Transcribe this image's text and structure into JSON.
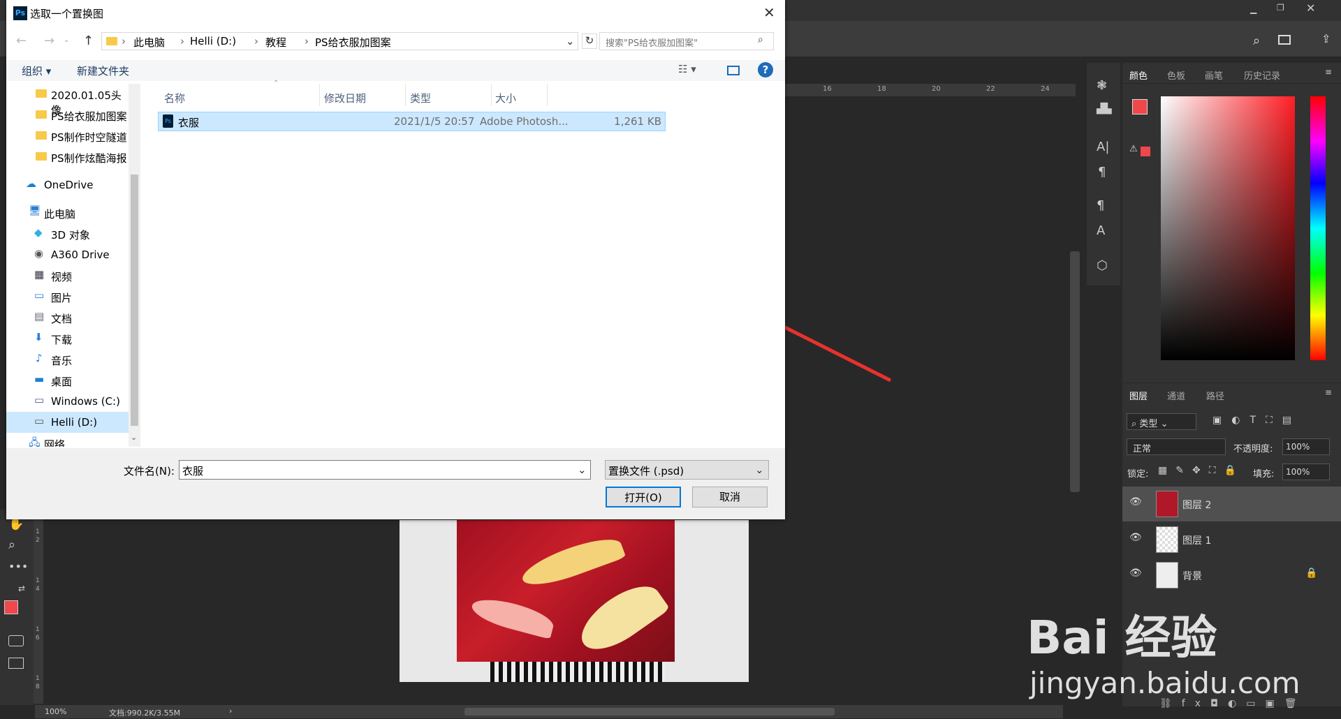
{
  "photoshop": {
    "ruler_ticks": [
      "16",
      "18",
      "20",
      "22",
      "24"
    ],
    "left_ruler": [
      "1",
      "2",
      "1",
      "4",
      "1",
      "6",
      "1",
      "8"
    ],
    "status": {
      "zoom": "100%",
      "doc": "文档:990.2K/3.55M",
      "arrow": "›"
    },
    "panel_tabs": [
      "颜色",
      "色板",
      "画笔",
      "历史记录"
    ],
    "layer_tabs": [
      "图层",
      "通道",
      "路径"
    ],
    "filter_label": "类型",
    "blend_mode": "正常",
    "opacity_label": "不透明度:",
    "opacity_value": "100%",
    "lock_label": "锁定:",
    "fill_label": "填充:",
    "fill_value": "100%",
    "layers": [
      {
        "name": "图层 2"
      },
      {
        "name": "图层 1"
      },
      {
        "name": "背景"
      }
    ],
    "fg_color": "#f0474b",
    "bg_color": "#000000"
  },
  "dialog": {
    "title": "选取一个置换图",
    "app_icon": "Ps",
    "breadcrumb": [
      "此电脑",
      "Helli (D:)",
      "教程",
      "PS给衣服加图案"
    ],
    "search_placeholder": "搜索\"PS给衣服加图案\"",
    "organize": "组织 ▾",
    "new_folder": "新建文件夹",
    "nav": [
      {
        "label": "2020.01.05头像",
        "icon": "folder-icon"
      },
      {
        "label": "PS给衣服加图案",
        "icon": "folder-icon"
      },
      {
        "label": "PS制作时空隧道",
        "icon": "folder-icon"
      },
      {
        "label": "PS制作炫酷海报",
        "icon": "folder-icon"
      },
      {
        "label": "OneDrive",
        "icon": "cloud-icon"
      },
      {
        "label": "此电脑",
        "icon": "computer-icon"
      },
      {
        "label": "3D 对象",
        "icon": "cube-icon"
      },
      {
        "label": "A360 Drive",
        "icon": "drive-icon"
      },
      {
        "label": "视频",
        "icon": "video-icon"
      },
      {
        "label": "图片",
        "icon": "picture-icon"
      },
      {
        "label": "文档",
        "icon": "document-icon"
      },
      {
        "label": "下载",
        "icon": "download-icon"
      },
      {
        "label": "音乐",
        "icon": "music-icon"
      },
      {
        "label": "桌面",
        "icon": "desktop-icon"
      },
      {
        "label": "Windows (C:)",
        "icon": "disk-icon"
      },
      {
        "label": "Helli (D:)",
        "icon": "disk-icon"
      },
      {
        "label": "网络",
        "icon": "network-icon"
      }
    ],
    "columns": {
      "name": "名称",
      "date": "修改日期",
      "type": "类型",
      "size": "大小"
    },
    "files": [
      {
        "name": "衣服",
        "date": "2021/1/5 20:57",
        "type": "Adobe Photosh...",
        "size": "1,261 KB"
      }
    ],
    "filename_label": "文件名(N):",
    "filename_value": "衣服",
    "filetype": "置换文件 (.psd)",
    "open_button": "打开(O)",
    "cancel_button": "取消"
  },
  "watermark": {
    "brand": "Bai 经验",
    "url": "jingyan.baidu.com"
  }
}
